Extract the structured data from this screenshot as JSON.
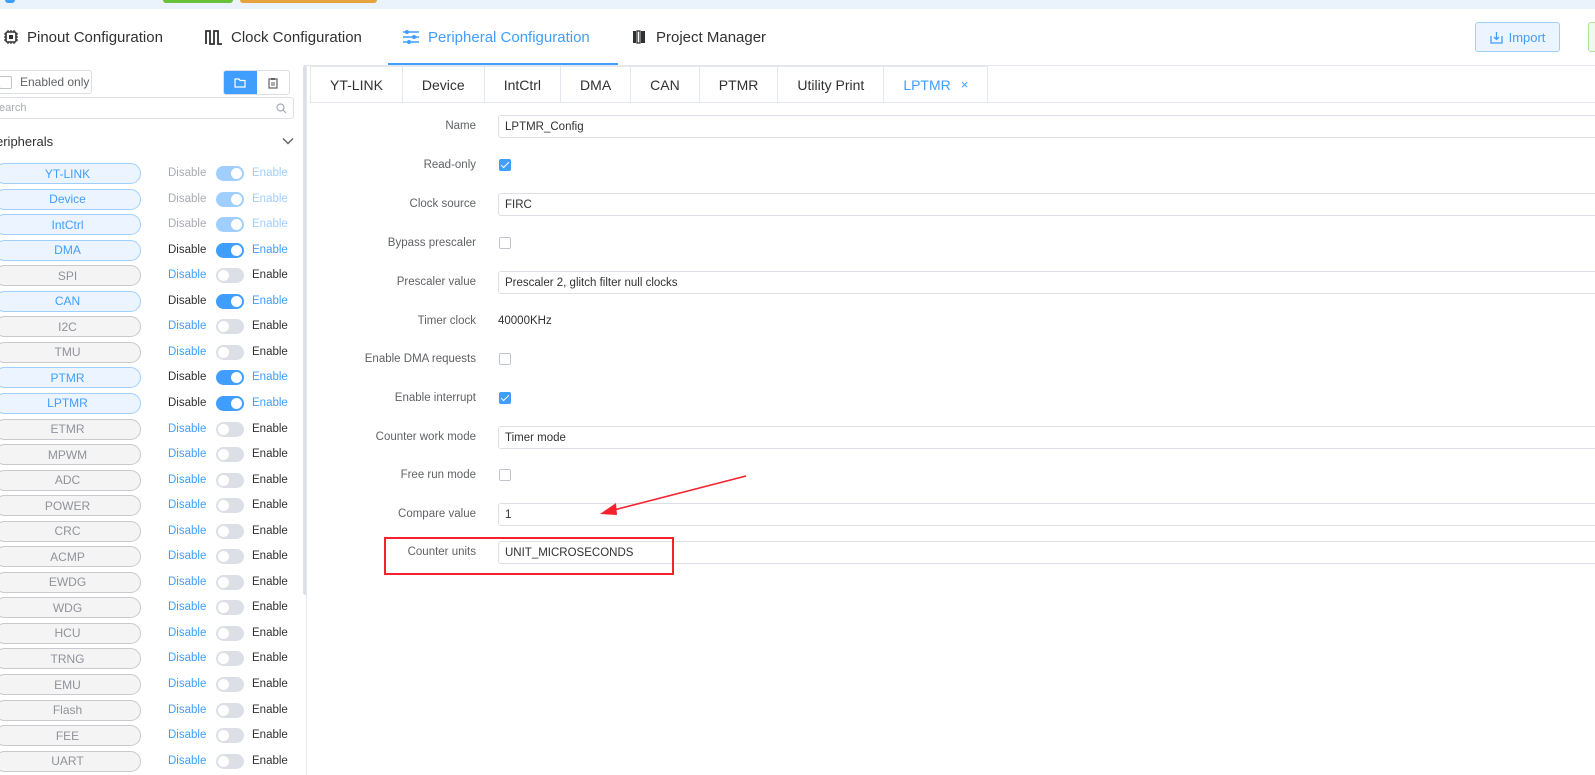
{
  "main_nav": {
    "pinout": "Pinout Configuration",
    "clock": "Clock Configuration",
    "peripheral": "Peripheral Configuration",
    "project": "Project Manager",
    "import": "Import"
  },
  "sidebar": {
    "enabled_only": "Enabled only",
    "search_placeholder": "earch",
    "section_title": "eripherals",
    "items": [
      {
        "name": "YT-LINK",
        "disable": "Disable",
        "enable": "Enable",
        "state": "locked"
      },
      {
        "name": "Device",
        "disable": "Disable",
        "enable": "Enable",
        "state": "locked"
      },
      {
        "name": "IntCtrl",
        "disable": "Disable",
        "enable": "Enable",
        "state": "locked"
      },
      {
        "name": "DMA",
        "disable": "Disable",
        "enable": "Enable",
        "state": "on"
      },
      {
        "name": "SPI",
        "disable": "Disable",
        "enable": "Enable",
        "state": "off"
      },
      {
        "name": "CAN",
        "disable": "Disable",
        "enable": "Enable",
        "state": "on"
      },
      {
        "name": "I2C",
        "disable": "Disable",
        "enable": "Enable",
        "state": "off"
      },
      {
        "name": "TMU",
        "disable": "Disable",
        "enable": "Enable",
        "state": "off"
      },
      {
        "name": "PTMR",
        "disable": "Disable",
        "enable": "Enable",
        "state": "on"
      },
      {
        "name": "LPTMR",
        "disable": "Disable",
        "enable": "Enable",
        "state": "on"
      },
      {
        "name": "ETMR",
        "disable": "Disable",
        "enable": "Enable",
        "state": "off"
      },
      {
        "name": "MPWM",
        "disable": "Disable",
        "enable": "Enable",
        "state": "off"
      },
      {
        "name": "ADC",
        "disable": "Disable",
        "enable": "Enable",
        "state": "off"
      },
      {
        "name": "POWER",
        "disable": "Disable",
        "enable": "Enable",
        "state": "off"
      },
      {
        "name": "CRC",
        "disable": "Disable",
        "enable": "Enable",
        "state": "off"
      },
      {
        "name": "ACMP",
        "disable": "Disable",
        "enable": "Enable",
        "state": "off"
      },
      {
        "name": "EWDG",
        "disable": "Disable",
        "enable": "Enable",
        "state": "off"
      },
      {
        "name": "WDG",
        "disable": "Disable",
        "enable": "Enable",
        "state": "off"
      },
      {
        "name": "HCU",
        "disable": "Disable",
        "enable": "Enable",
        "state": "off"
      },
      {
        "name": "TRNG",
        "disable": "Disable",
        "enable": "Enable",
        "state": "off"
      },
      {
        "name": "EMU",
        "disable": "Disable",
        "enable": "Enable",
        "state": "off"
      },
      {
        "name": "Flash",
        "disable": "Disable",
        "enable": "Enable",
        "state": "off"
      },
      {
        "name": "FEE",
        "disable": "Disable",
        "enable": "Enable",
        "state": "off"
      },
      {
        "name": "UART",
        "disable": "Disable",
        "enable": "Enable",
        "state": "off"
      }
    ]
  },
  "tabs": [
    {
      "label": "YT-LINK"
    },
    {
      "label": "Device"
    },
    {
      "label": "IntCtrl"
    },
    {
      "label": "DMA"
    },
    {
      "label": "CAN"
    },
    {
      "label": "PTMR"
    },
    {
      "label": "Utility Print"
    },
    {
      "label": "LPTMR",
      "active": true,
      "close": "×"
    }
  ],
  "form": {
    "name": {
      "label": "Name",
      "value": "LPTMR_Config"
    },
    "read_only": {
      "label": "Read-only",
      "checked": true
    },
    "clock_source": {
      "label": "Clock source",
      "value": "FIRC"
    },
    "bypass_prescaler": {
      "label": "Bypass prescaler",
      "checked": false
    },
    "prescaler_value": {
      "label": "Prescaler value",
      "value": "Prescaler 2, glitch filter null clocks"
    },
    "timer_clock": {
      "label": "Timer clock",
      "value": "40000KHz"
    },
    "enable_dma": {
      "label": "Enable DMA requests",
      "checked": false
    },
    "enable_interrupt": {
      "label": "Enable interrupt",
      "checked": true
    },
    "counter_work_mode": {
      "label": "Counter work mode",
      "value": "Timer mode"
    },
    "free_run_mode": {
      "label": "Free run mode",
      "checked": false
    },
    "compare_value": {
      "label": "Compare value",
      "value": "1"
    },
    "counter_units": {
      "label": "Counter units",
      "value": "UNIT_MICROSECONDS"
    }
  },
  "annotation": {
    "color": "#f5222d"
  },
  "colors": {
    "accent": "#409eff",
    "annotation": "#f5222d"
  }
}
